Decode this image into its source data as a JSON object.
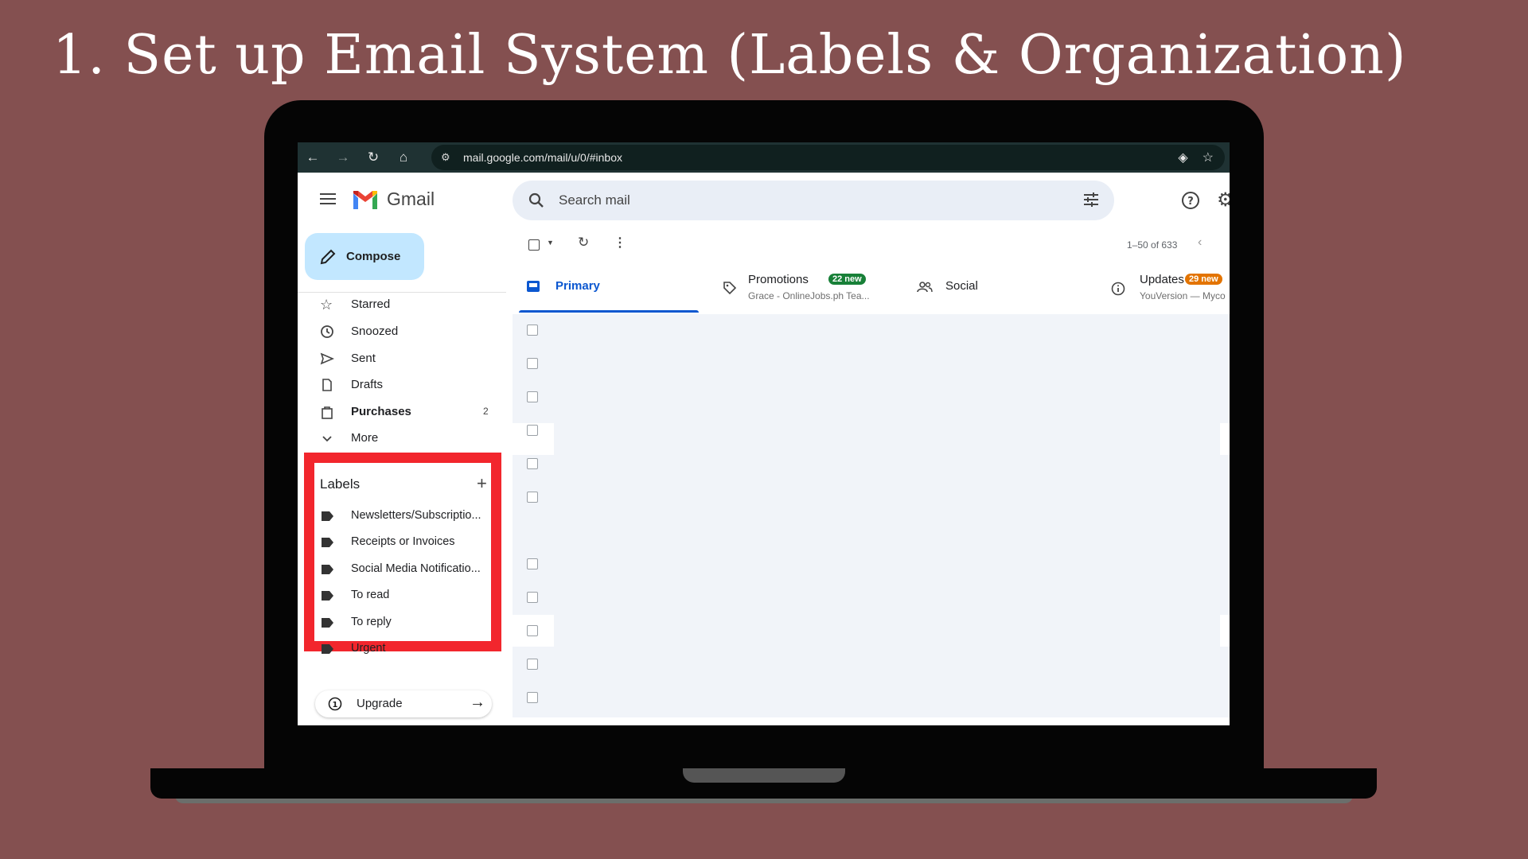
{
  "slide_title": "1. Set up Email System (Labels & Organization)",
  "browser": {
    "url": "mail.google.com/mail/u/0/#inbox"
  },
  "app": {
    "name": "Gmail",
    "search_placeholder": "Search mail"
  },
  "sidebar": {
    "compose_label": "Compose",
    "items": [
      {
        "label": "Starred",
        "icon": "star-icon",
        "count": ""
      },
      {
        "label": "Snoozed",
        "icon": "clock-icon",
        "count": ""
      },
      {
        "label": "Sent",
        "icon": "send-icon",
        "count": ""
      },
      {
        "label": "Drafts",
        "icon": "draft-icon",
        "count": ""
      },
      {
        "label": "Purchases",
        "icon": "shopping-bag-icon",
        "count": "2"
      },
      {
        "label": "More",
        "icon": "chevron-down-icon",
        "count": ""
      }
    ],
    "labels_title": "Labels",
    "labels": [
      "Newsletters/Subscriptio...",
      "Receipts or Invoices",
      "Social Media Notificatio...",
      "To read",
      "To reply",
      "Urgent"
    ],
    "upgrade_label": "Upgrade",
    "highlight_color": "#f2262d"
  },
  "toolbar": {
    "pager": "1–50 of 633"
  },
  "tabs": [
    {
      "label": "Primary",
      "sub": "",
      "badge": "",
      "active": true
    },
    {
      "label": "Promotions",
      "sub": "Grace - OnlineJobs.ph Tea...",
      "badge": "22 new",
      "badge_color": "#188038"
    },
    {
      "label": "Social",
      "sub": "",
      "badge": ""
    },
    {
      "label": "Updates",
      "sub": "YouVersion — Myco",
      "badge": "29 new",
      "badge_color": "#e37400"
    }
  ],
  "colors": {
    "background": "#845050",
    "compose_bg": "#c2e7ff",
    "accent_blue": "#0b57d0"
  }
}
